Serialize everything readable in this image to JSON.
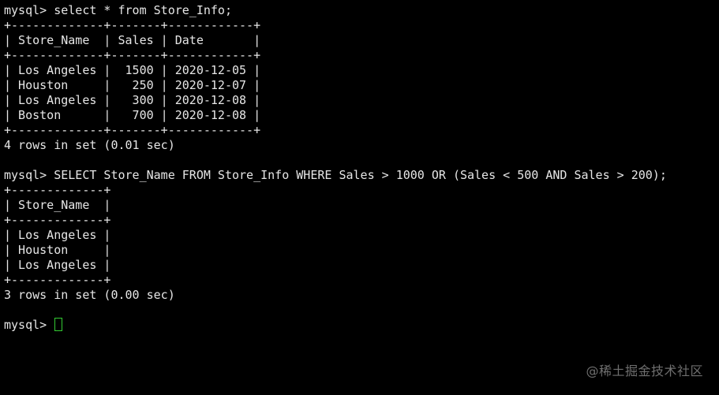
{
  "terminal": {
    "lines": [
      "mysql> select * from Store_Info;",
      "+-------------+-------+------------+",
      "| Store_Name  | Sales | Date       |",
      "+-------------+-------+------------+",
      "| Los Angeles |  1500 | 2020-12-05 |",
      "| Houston     |   250 | 2020-12-07 |",
      "| Los Angeles |   300 | 2020-12-08 |",
      "| Boston      |   700 | 2020-12-08 |",
      "+-------------+-------+------------+",
      "4 rows in set (0.01 sec)",
      "",
      "mysql> SELECT Store_Name FROM Store_Info WHERE Sales > 1000 OR (Sales < 500 AND Sales > 200);",
      "+-------------+",
      "| Store_Name  |",
      "+-------------+",
      "| Los Angeles |",
      "| Houston     |",
      "| Los Angeles |",
      "+-------------+",
      "3 rows in set (0.00 sec)",
      ""
    ],
    "prompt": "mysql> "
  },
  "watermark": "@稀土掘金技术社区",
  "colors": {
    "background": "#000000",
    "text": "#e6e6e6",
    "cursor": "#33cc33",
    "watermark": "#6f6f6f"
  }
}
